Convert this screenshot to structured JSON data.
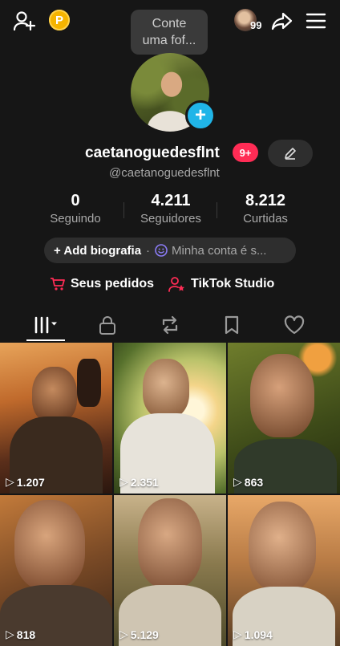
{
  "topbar": {
    "p_badge": "P",
    "story_bubble": [
      "Conte",
      "uma fof..."
    ],
    "mini_avatar_count": "99"
  },
  "profile": {
    "username": "caetanoguedesflnt",
    "notifications_badge": "9+",
    "handle": "@caetanoguedesflnt",
    "stats": [
      {
        "value": "0",
        "label": "Seguindo"
      },
      {
        "value": "4.211",
        "label": "Seguidores"
      },
      {
        "value": "8.212",
        "label": "Curtidas"
      }
    ],
    "bio_button": "+ Add biografia",
    "bio_separator": "·",
    "bio_account": "Minha conta é s..."
  },
  "actions": {
    "orders": "Seus pedidos",
    "studio": "TikTok Studio"
  },
  "tabs": [
    "videos",
    "private",
    "reposts",
    "favorites",
    "liked"
  ],
  "videos": [
    {
      "views": "1.207"
    },
    {
      "views": "2.351"
    },
    {
      "views": "863"
    },
    {
      "views": "818"
    },
    {
      "views": "5.129"
    },
    {
      "views": "1.094"
    }
  ],
  "colors": {
    "accent": "#ff2c55",
    "plus": "#20b5e8",
    "background": "#161616"
  }
}
